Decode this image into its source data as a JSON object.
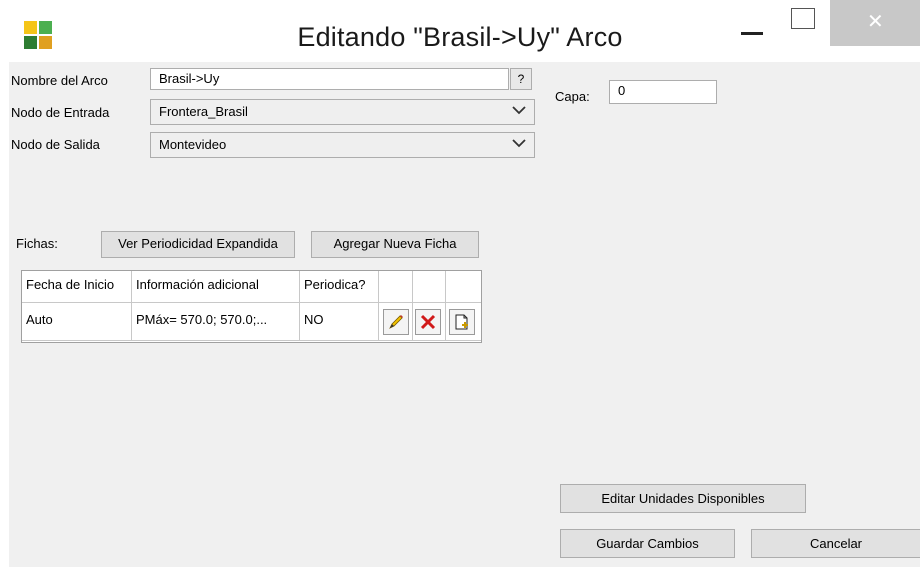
{
  "window": {
    "title": "Editando \"Brasil->Uy\" Arco",
    "close_glyph": "✕",
    "icon": "app-grid-icon",
    "icon_colors": [
      "#f5c518",
      "#4caf50",
      "#2e7d32",
      "#e0a020"
    ]
  },
  "form": {
    "nombre_label": "Nombre del Arco",
    "nombre_value": "Brasil->Uy",
    "help_label": "?",
    "entrada_label": "Nodo de Entrada",
    "entrada_value": "Frontera_Brasil",
    "salida_label": "Nodo de Salida",
    "salida_value": "Montevideo",
    "capa_label": "Capa:",
    "capa_value": "0"
  },
  "fichas": {
    "label": "Fichas:",
    "ver_button": "Ver Periodicidad Expandida",
    "agregar_button": "Agregar Nueva Ficha",
    "columns": [
      "Fecha de Inicio",
      "Información adicional",
      "Periodica?"
    ],
    "rows": [
      {
        "fecha": "Auto",
        "info": "PMáx= 570.0; 570.0;...",
        "periodica": "NO"
      }
    ],
    "row_icons": [
      "edit-icon",
      "delete-icon",
      "add-document-icon"
    ]
  },
  "footer": {
    "editar_button": "Editar Unidades Disponibles",
    "guardar_button": "Guardar Cambios",
    "cancelar_button": "Cancelar"
  },
  "colors": {
    "client_bg": "#f0f0f0",
    "close_btn_bg": "#c8c8c8",
    "delete_red": "#d11a1a",
    "pencil_yellow": "#f2c200"
  }
}
